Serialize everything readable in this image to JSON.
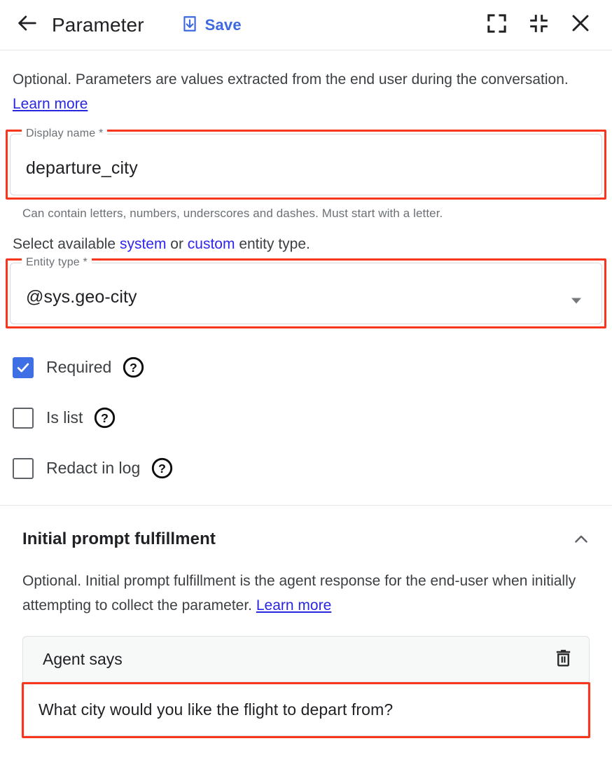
{
  "header": {
    "back_icon": "arrow-left-icon",
    "title": "Parameter",
    "save_label": "Save",
    "save_icon": "save-download-icon",
    "fullscreen_icon": "expand-fullscreen-icon",
    "collapse_icon": "collapse-fullscreen-icon",
    "close_icon": "close-x-icon"
  },
  "intro": {
    "text": "Optional. Parameters are values extracted from the end user during the conversation. ",
    "link": "Learn more"
  },
  "display_name_field": {
    "label": "Display name *",
    "value": "departure_city",
    "hint": "Can contain letters, numbers, underscores and dashes. Must start with a letter.",
    "highlighted": true
  },
  "entity_select_line": {
    "prefix": "Select available ",
    "link_system": "system",
    "middle": " or ",
    "link_custom": "custom",
    "suffix": " entity type."
  },
  "entity_type_field": {
    "label": "Entity type *",
    "value": "@sys.geo-city",
    "dropdown_icon": "triangle-down-icon",
    "highlighted": true
  },
  "checkboxes": [
    {
      "label": "Required",
      "checked": true,
      "help_icon": "help-circle-icon"
    },
    {
      "label": "Is list",
      "checked": false,
      "help_icon": "help-circle-icon"
    },
    {
      "label": "Redact in log",
      "checked": false,
      "help_icon": "help-circle-icon"
    }
  ],
  "section": {
    "title": "Initial prompt fulfillment",
    "chevron_icon": "chevron-up-icon",
    "expanded": true,
    "description": "Optional. Initial prompt fulfillment is the agent response for the end-user when initially attempting to collect the parameter. ",
    "description_link": "Learn more"
  },
  "agent_says": {
    "header_label": "Agent says",
    "delete_icon": "trash-icon",
    "message": "What city would you like the flight to depart from?",
    "highlighted": true
  },
  "colors": {
    "accent_blue": "#3d6ae0",
    "link_blue": "#2826e0",
    "highlight_red": "#f8361e",
    "checkbox_checked": "#3f6fe5",
    "text_primary": "#202124",
    "text_secondary": "#6b7075"
  }
}
